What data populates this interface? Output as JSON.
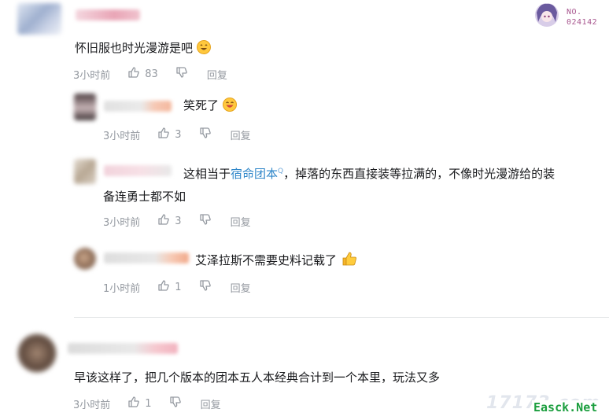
{
  "comments": [
    {
      "text": "怀旧服也时光漫游是吧",
      "time": "3小时前",
      "likes": "83",
      "reply_label": "回复",
      "replies": [
        {
          "text": "笑死了",
          "time": "3小时前",
          "likes": "3",
          "reply_label": "回复"
        },
        {
          "text_before": "这相当于",
          "link_text": "宿命团本",
          "link_sup": "Q",
          "text_after": "，掉落的东西直接装等拉满的，不像时光漫游给的装",
          "text_line2": "备连勇士都不如",
          "time": "3小时前",
          "likes": "3",
          "reply_label": "回复"
        },
        {
          "text": "艾泽拉斯不需要史料记载了",
          "time": "1小时前",
          "likes": "1",
          "reply_label": "回复"
        }
      ]
    },
    {
      "text": "早该这样了，把几个版本的团本五人本经典合计到一个本里，玩法又多",
      "time": "3小时前",
      "likes": "1",
      "reply_label": "回复"
    }
  ],
  "badge": {
    "label": "NO.",
    "number": "024142"
  },
  "watermarks": {
    "site1": "17173.com",
    "site2": "Easck.Net"
  },
  "icons": [
    "thumbs-up-icon",
    "thumbs-down-icon",
    "laugh-emoji-icon",
    "thumbs-up-emoji-icon",
    "search-superscript-icon"
  ],
  "colors": {
    "link": "#2f86c9",
    "meta": "#9499a0",
    "watermark2": "#1b9e3e"
  }
}
